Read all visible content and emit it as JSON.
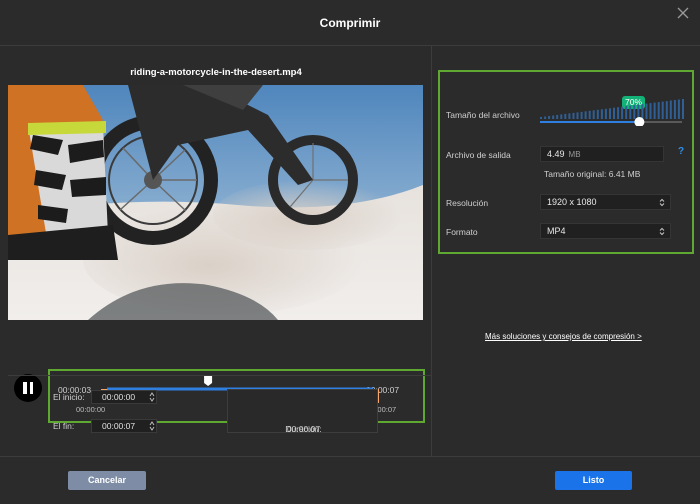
{
  "dialog": {
    "title": "Comprimir"
  },
  "video": {
    "file_name": "riding-a-motorcycle-in-the-desert.mp4"
  },
  "timeline": {
    "current_left": "00:00:03",
    "current_right": "00:00:07",
    "start_marker": "00:00:00",
    "end_marker": "00:00:07",
    "playhead_fraction": 0.38,
    "trim_start_fraction": 0.0,
    "trim_end_fraction": 1.0
  },
  "trim": {
    "start_label": "El inicio:",
    "start_value": "00:00:00",
    "end_label": "El fin:",
    "end_value": "00:00:07",
    "duration_label": "Duración:",
    "duration_value": "00:00:07"
  },
  "settings": {
    "size_label": "Tamaño del archivo",
    "size_percent": "70%",
    "size_fraction": 0.7,
    "output_label": "Archivo de salida",
    "output_value": "4.49",
    "output_unit": "MB",
    "help": "?",
    "original_size": "Tamaño original: 6.41 MB",
    "resolution_label": "Resolución",
    "resolution_value": "1920 x 1080",
    "format_label": "Formato",
    "format_value": "MP4"
  },
  "tips_link": "Más soluciones y consejos de compresión >",
  "footer": {
    "cancel": "Cancelar",
    "ok": "Listo"
  },
  "colors": {
    "accent": "#1a73e8",
    "highlight_border": "#5fa832",
    "badge": "#12b278",
    "trim_handle": "#f7a56a"
  }
}
